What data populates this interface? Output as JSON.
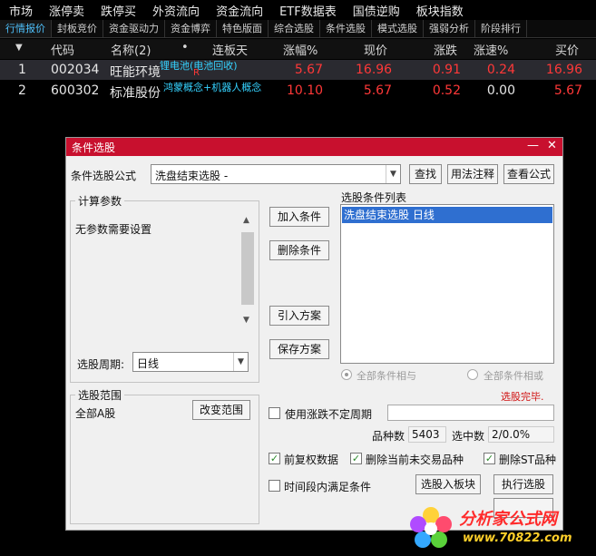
{
  "menu": [
    "市场",
    "涨停卖",
    "跌停买",
    "外资流向",
    "资金流向",
    "ETF数据表",
    "国债逆购",
    "板块指数"
  ],
  "tabs": [
    "行情报价",
    "封板竞价",
    "资金驱动力",
    "资金博弈",
    "特色版面",
    "综合选股",
    "条件选股",
    "模式选股",
    "强弱分析",
    "阶段排行"
  ],
  "quote": {
    "sort_glyph": "▼",
    "headers": [
      "代码",
      "名称(2)",
      "•",
      "连板天",
      "涨幅%",
      "现价",
      "涨跌",
      "涨速%",
      "买价"
    ],
    "rows": [
      {
        "idx": "1",
        "code": "002034",
        "name": "旺能环境",
        "flag": "R",
        "concept": "锂电池(电池回收)",
        "pct": "5.67",
        "price": "16.96",
        "chg": "0.91",
        "speed": "0.24",
        "bid": "16.96"
      },
      {
        "idx": "2",
        "code": "600302",
        "name": "标准股份",
        "concept": "鸿蒙概念+机器人概念",
        "pct": "10.10",
        "price": "5.67",
        "chg": "0.52",
        "speed": "0.00",
        "bid": "5.67"
      }
    ]
  },
  "dialog": {
    "title": "条件选股",
    "min_glyph": "—",
    "close_glyph": "✕",
    "formula_label": "条件选股公式",
    "formula_value": "洗盘结束选股  -",
    "find_btn": "查找",
    "usage_btn": "用法注释",
    "view_btn": "查看公式",
    "params_title": "计算参数",
    "params_text": "无参数需要设置",
    "add_btn": "加入条件",
    "del_btn": "删除条件",
    "import_btn": "引入方案",
    "save_btn": "保存方案",
    "list_title": "选股条件列表",
    "list_items": [
      "洗盘结束选股  日线"
    ],
    "period_label": "选股周期:",
    "period_value": "日线",
    "radio_and": "全部条件相与",
    "radio_or": "全部条件相或",
    "status": "选股完毕.",
    "range_title": "选股范围",
    "range_value": "全部A股",
    "change_range_btn": "改变范围",
    "variable_period": "使用涨跌不定周期",
    "count_label": "品种数",
    "count_value": "5403",
    "selected_label": "选中数",
    "selected_value": "2/0.0%",
    "opt_adjust": "前复权数据",
    "opt_exclude_untraded": "删除当前未交易品种",
    "opt_exclude_st": "删除ST品种",
    "opt_time_range": "时间段内满足条件",
    "to_block_btn": "选股入板块",
    "run_btn": "执行选股"
  },
  "logo": {
    "name": "分析家公式网",
    "url": "www.70822.com"
  },
  "colors": {
    "title_bar": "#c8102e",
    "up": "#ff3838",
    "selection": "#2f6fd0",
    "status": "#d01010"
  }
}
